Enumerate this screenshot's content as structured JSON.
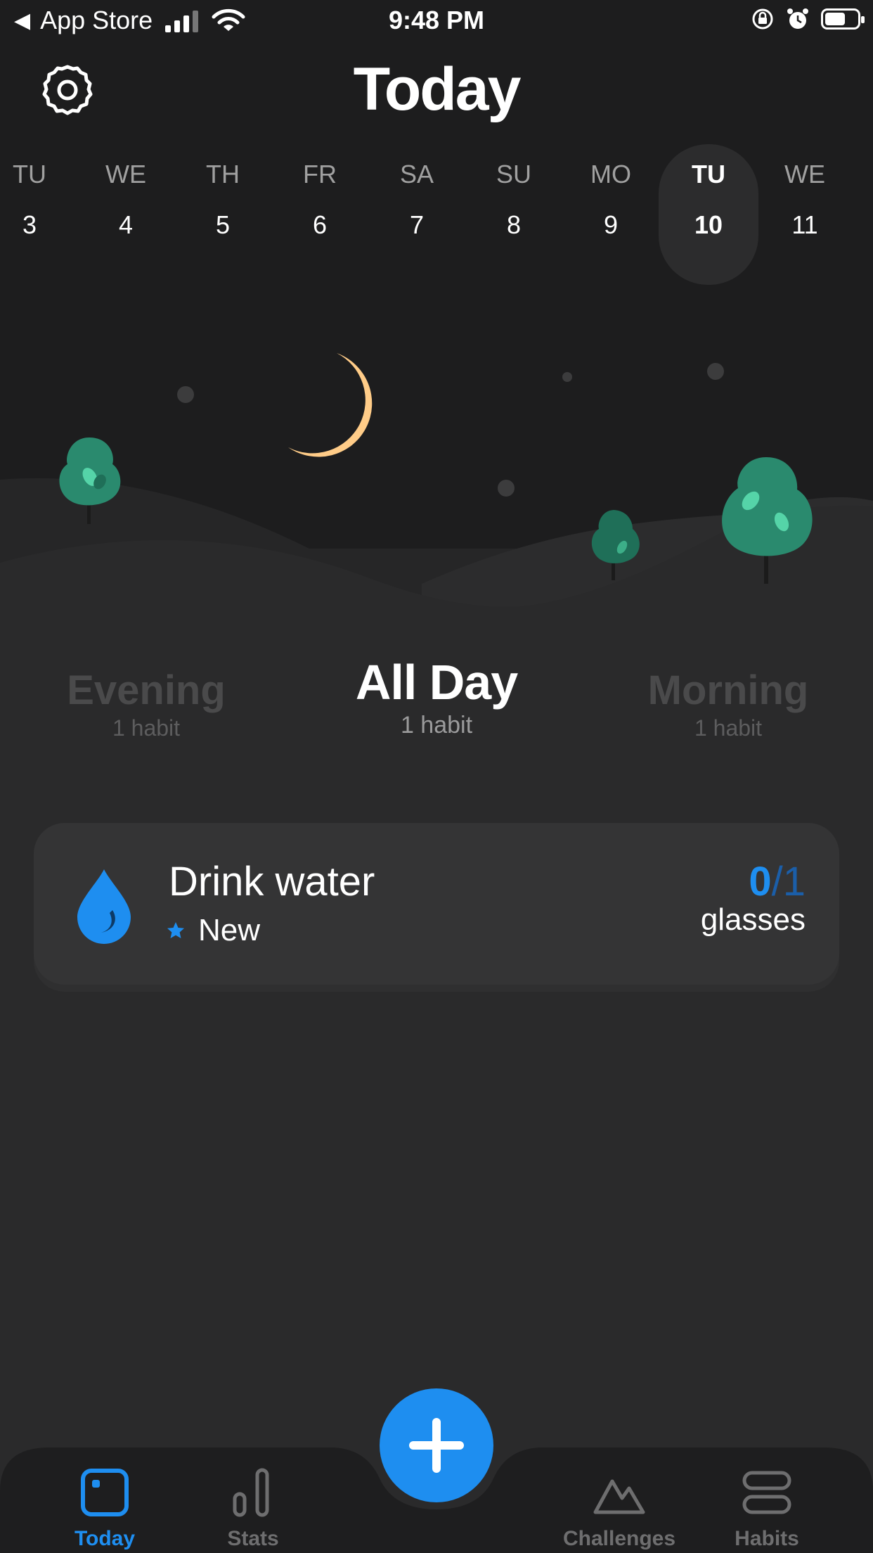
{
  "status_bar": {
    "back_label": "App Store",
    "time": "9:48 PM"
  },
  "header": {
    "title": "Today",
    "settings_icon": "gear-icon"
  },
  "calendar": {
    "days": [
      {
        "dow": "TU",
        "num": "3"
      },
      {
        "dow": "WE",
        "num": "4"
      },
      {
        "dow": "TH",
        "num": "5"
      },
      {
        "dow": "FR",
        "num": "6"
      },
      {
        "dow": "SA",
        "num": "7"
      },
      {
        "dow": "SU",
        "num": "8"
      },
      {
        "dow": "MO",
        "num": "9"
      },
      {
        "dow": "TU",
        "num": "10"
      },
      {
        "dow": "WE",
        "num": "11"
      }
    ],
    "selected_index": 7
  },
  "segments": [
    {
      "title": "Evening",
      "subtitle": "1 habit"
    },
    {
      "title": "All Day",
      "subtitle": "1 habit"
    },
    {
      "title": "Morning",
      "subtitle": "1 habit"
    }
  ],
  "habit": {
    "name": "Drink water",
    "tag": "New",
    "current": "0",
    "separator": "/",
    "target": "1",
    "unit": "glasses",
    "icon": "water-drop-icon",
    "tag_icon": "star-icon"
  },
  "tabs": [
    {
      "label": "Today",
      "icon": "today-icon",
      "active": true
    },
    {
      "label": "Stats",
      "icon": "stats-icon",
      "active": false
    },
    {
      "label": "Challenges",
      "icon": "challenges-icon",
      "active": false
    },
    {
      "label": "Habits",
      "icon": "habits-icon",
      "active": false
    }
  ],
  "colors": {
    "accent": "#1e8ef0",
    "background": "#2a2a2b",
    "moon": "#ffcc88",
    "tree": "#2a8a6e"
  }
}
